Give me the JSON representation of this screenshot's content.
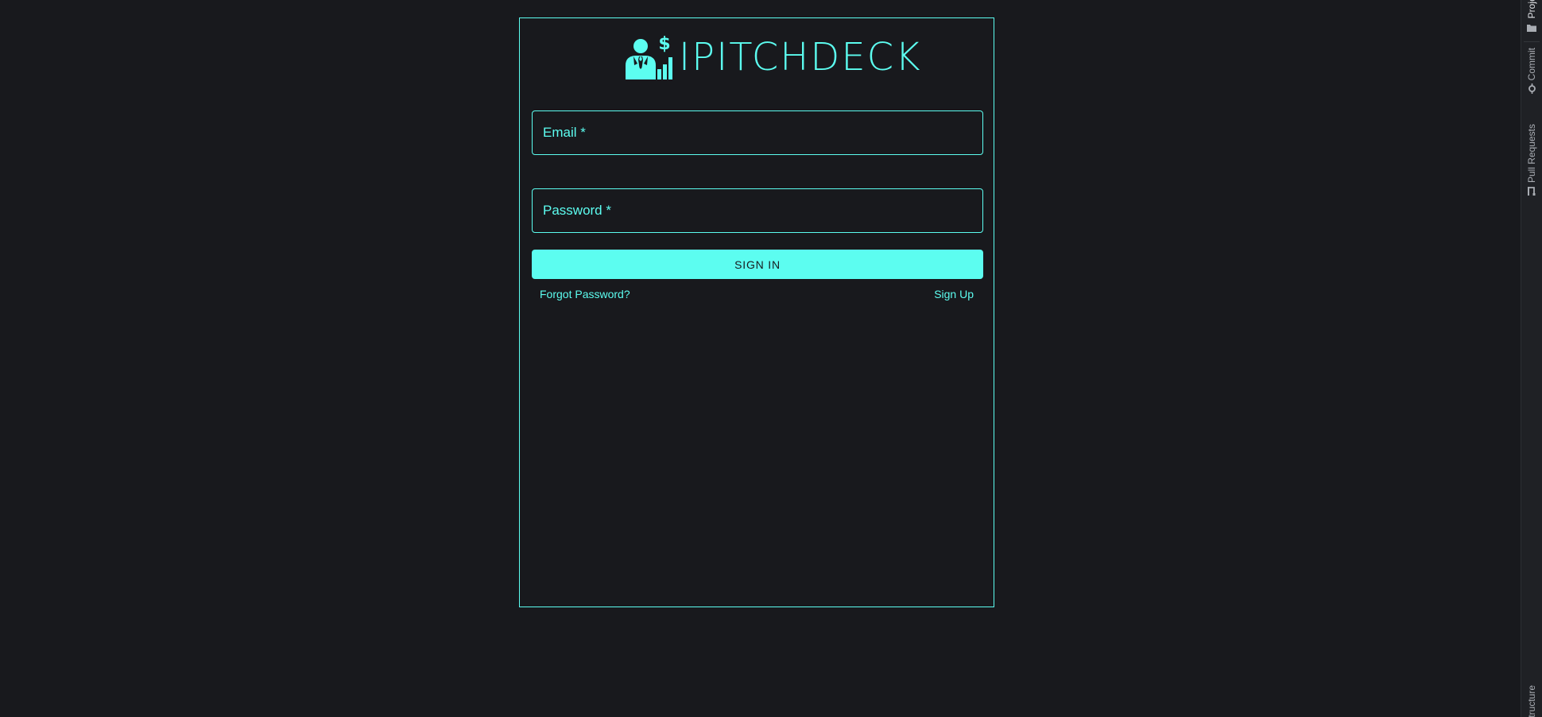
{
  "app": {
    "logo_text": "IPITCHDECK",
    "logo_icon": "businessman-dollar-growth-icon",
    "accent_color": "#5cfdf0",
    "background_color": "#18191d"
  },
  "login": {
    "email_label": "Email *",
    "email_value": "",
    "password_label": "Password *",
    "password_value": "",
    "signin_label": "SIGN IN",
    "forgot_label": "Forgot Password?",
    "signup_label": "Sign Up"
  },
  "toolstrip": {
    "project_label": "Project",
    "commit_label": "Commit",
    "pull_requests_label": "Pull Requests",
    "structure_label": "Structure"
  }
}
